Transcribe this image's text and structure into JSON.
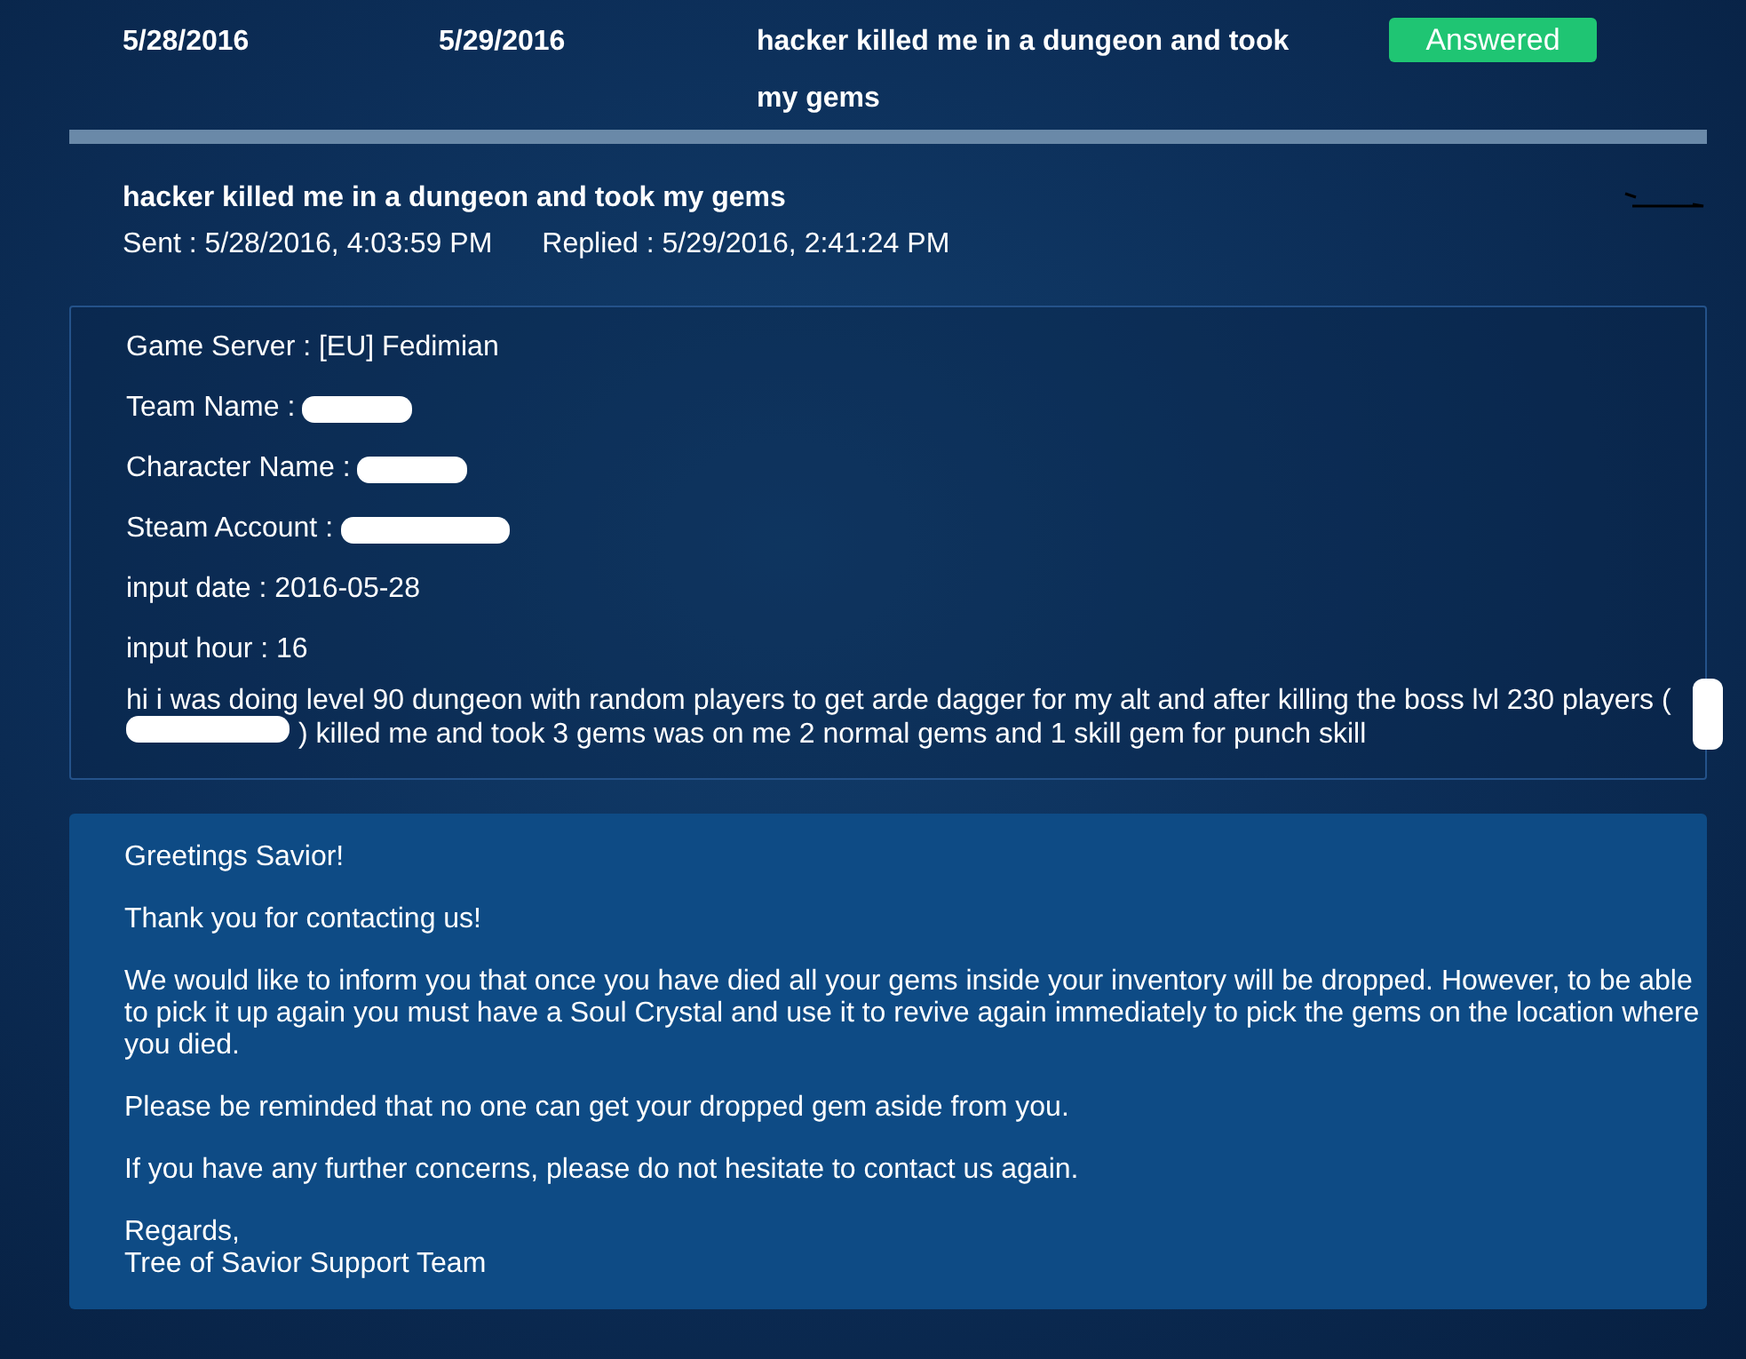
{
  "ticket_row": {
    "sent_date": "5/28/2016",
    "replied_date": "5/29/2016",
    "subject": "hacker killed me in a dungeon and took my gems",
    "status": "Answered"
  },
  "ticket": {
    "title": "hacker killed me in a dungeon and took my gems",
    "sent": "Sent : 5/28/2016, 4:03:59 PM",
    "replied": "Replied : 5/29/2016, 2:41:24 PM"
  },
  "request": {
    "fields": [
      {
        "label": "Game Server : [EU] Fedimian",
        "redacted": false
      },
      {
        "label": "Team Name :",
        "redacted": true
      },
      {
        "label": "Character Name :",
        "redacted": true
      },
      {
        "label": "Steam Account :",
        "redacted": true
      },
      {
        "label": "input date : 2016-05-28",
        "redacted": false
      },
      {
        "label": "input hour : 16",
        "redacted": false
      }
    ],
    "message_before": "hi i was doing level 90 dungeon with random players to get arde dagger for my alt and after killing the boss lvl 230 players (",
    "message_after": ") killed me and took 3 gems was on me 2 normal gems and 1 skill gem for punch skill"
  },
  "reply": {
    "paragraphs": [
      "Greetings Savior!",
      "Thank you for contacting us!",
      "We would like to inform you that once you have died all your gems inside your inventory will be dropped. However, to be able to pick it up again you must have a Soul Crystal and use it to revive again immediately to pick the gems on the location where you died.",
      "Please be reminded that no one can get your dropped gem aside from you.",
      "If you have any further concerns, please do not hesitate to contact us again."
    ],
    "closing": "Regards,",
    "signature": "Tree of Savior Support Team"
  }
}
